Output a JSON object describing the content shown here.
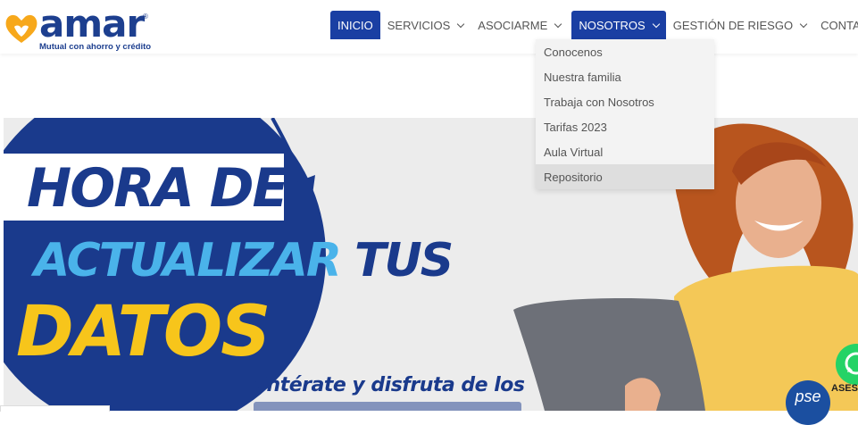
{
  "brand": {
    "name": "amar",
    "registered": "®",
    "tagline": "Mutual con ahorro y crédito"
  },
  "nav": {
    "items": [
      {
        "label": "INICIO"
      },
      {
        "label": "SERVICIOS"
      },
      {
        "label": "ASOCIARME"
      },
      {
        "label": "NOSOTROS"
      },
      {
        "label": "GESTIÓN DE RIESGO"
      },
      {
        "label": "CONTACTO"
      }
    ]
  },
  "dropdown": {
    "items": [
      {
        "label": "Conocenos"
      },
      {
        "label": "Nuestra familia"
      },
      {
        "label": "Trabaja con Nosotros"
      },
      {
        "label": "Tarifas 2023"
      },
      {
        "label": "Aula Virtual"
      },
      {
        "label": "Repositorio"
      }
    ]
  },
  "banner": {
    "line1": "HORA DE",
    "line2a": "ACTUALIZAR",
    "line2b": " TUS",
    "line3": "DATOS",
    "subtitle": "Entérate y disfruta de los"
  },
  "floating": {
    "whatsapp_label": "ASESO",
    "pse_label": "pse"
  },
  "colors": {
    "nav_active": "#1a3fa3",
    "brand_blue": "#1d3f8f",
    "brand_gold": "#f7a81b",
    "banner_yellow": "#f7c51b",
    "banner_light_blue": "#4ab3ea"
  }
}
